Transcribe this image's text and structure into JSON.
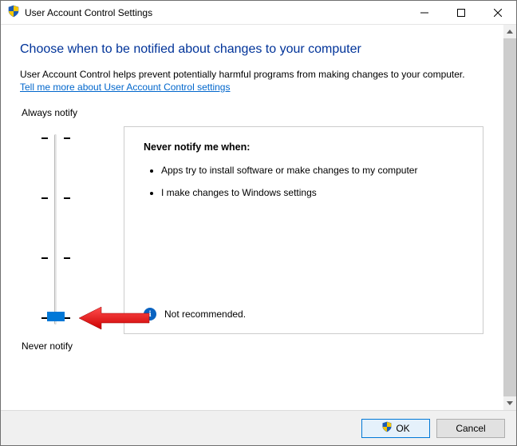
{
  "window": {
    "title": "User Account Control Settings"
  },
  "heading": "Choose when to be notified about changes to your computer",
  "description": "User Account Control helps prevent potentially harmful programs from making changes to your computer.",
  "help_link": "Tell me more about User Account Control settings",
  "slider": {
    "top_label": "Always notify",
    "bottom_label": "Never notify"
  },
  "infobox": {
    "title": "Never notify me when:",
    "items": [
      "Apps try to install software or make changes to my computer",
      "I make changes to Windows settings"
    ],
    "status_text": "Not recommended."
  },
  "buttons": {
    "ok": "OK",
    "cancel": "Cancel"
  }
}
